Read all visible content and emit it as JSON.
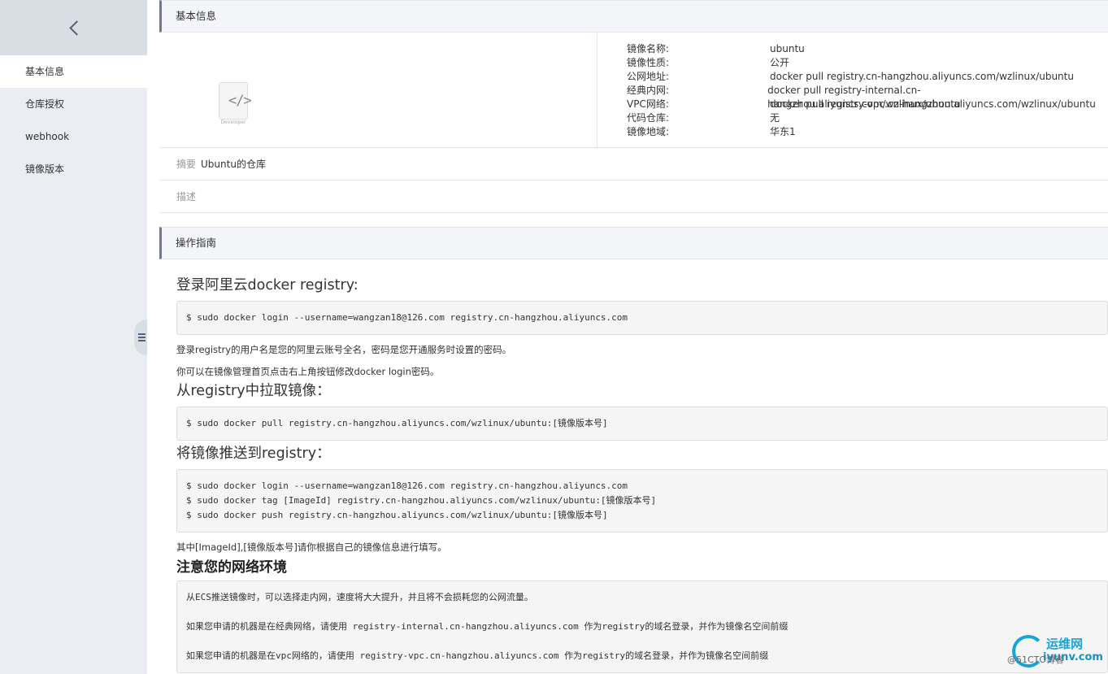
{
  "sidebar": {
    "back_icon": "chevron-left-icon",
    "items": [
      {
        "label": "基本信息",
        "active": true
      },
      {
        "label": "仓库授权",
        "active": false
      },
      {
        "label": "webhook",
        "active": false
      },
      {
        "label": "镜像版本",
        "active": false
      }
    ],
    "collapse_icon": "menu-icon"
  },
  "basic": {
    "header": "基本信息",
    "logo_caption": "Developer",
    "attrs": [
      {
        "key": "镜像名称:",
        "value": "ubuntu"
      },
      {
        "key": "镜像性质:",
        "value": "公开"
      },
      {
        "key": "公网地址:",
        "value": "docker pull registry.cn-hangzhou.aliyuncs.com/wzlinux/ubuntu"
      },
      {
        "key": "经典内网:",
        "value": "docker pull registry-internal.cn-hangzhou.aliyuncs.com/wzlinux/ubuntu"
      },
      {
        "key": "VPC网络:",
        "value": "docker pull registry-vpc.cn-hangzhou.aliyuncs.com/wzlinux/ubuntu"
      },
      {
        "key": "代码仓库:",
        "value": "无"
      },
      {
        "key": "镜像地域:",
        "value": "华东1"
      }
    ],
    "summary_label": "摘要",
    "summary_value": "Ubuntu的仓库",
    "desc_label": "描述"
  },
  "guide": {
    "header": "操作指南",
    "login_title": "登录阿里云docker registry:",
    "login_code": "$ sudo docker login --username=wangzan18@126.com registry.cn-hangzhou.aliyuncs.com",
    "login_note1": "登录registry的用户名是您的阿里云账号全名，密码是您开通服务时设置的密码。",
    "login_note2": "你可以在镜像管理首页点击右上角按钮修改docker login密码。",
    "pull_title": "从registry中拉取镜像：",
    "pull_code": "$ sudo docker pull registry.cn-hangzhou.aliyuncs.com/wzlinux/ubuntu:[镜像版本号]",
    "push_title": "将镜像推送到registry：",
    "push_code": "$ sudo docker login --username=wangzan18@126.com registry.cn-hangzhou.aliyuncs.com\n$ sudo docker tag [ImageId] registry.cn-hangzhou.aliyuncs.com/wzlinux/ubuntu:[镜像版本号]\n$ sudo docker push registry.cn-hangzhou.aliyuncs.com/wzlinux/ubuntu:[镜像版本号]",
    "push_note": "其中[ImageId],[镜像版本号]请你根据自己的镜像信息进行填写。",
    "network_title": "注意您的网络环境",
    "network_code": "从ECS推送镜像时，可以选择走内网，速度将大大提升，并且将不会损耗您的公网流量。\n\n如果您申请的机器是在经典网络，请使用 registry-internal.cn-hangzhou.aliyuncs.com 作为registry的域名登录，并作为镜像名空间前缀\n\n如果您申请的机器是在vpc网络的，请使用 registry-vpc.cn-hangzhou.aliyuncs.com 作为registry的域名登录，并作为镜像名空间前缀"
  },
  "watermark": {
    "line1": "运维网",
    "line2": "iyunv.com",
    "line3": "@51CTO博客"
  }
}
